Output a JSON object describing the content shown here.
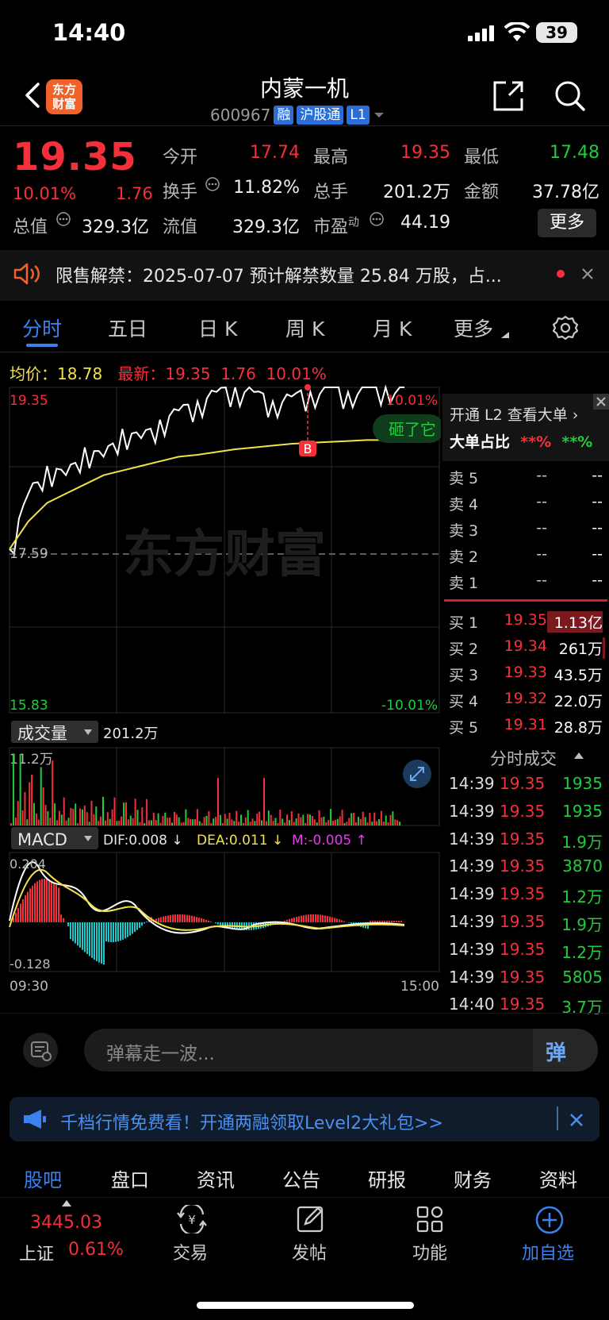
{
  "status_bar": {
    "time": "14:40",
    "battery": "39"
  },
  "header": {
    "logo_text": "东方\n财富",
    "title": "内蒙一机",
    "code": "600967",
    "tags": [
      "融",
      "沪股通",
      "L1"
    ]
  },
  "quote": {
    "price": "19.35",
    "change_pct": "10.01%",
    "change": "1.76",
    "fields": [
      {
        "label": "今开",
        "value": "17.74",
        "color": "red"
      },
      {
        "label": "最高",
        "value": "19.35",
        "color": "red"
      },
      {
        "label": "最低",
        "value": "17.48",
        "color": "green"
      },
      {
        "label": "换手",
        "value": "11.82%",
        "color": "white"
      },
      {
        "label": "总手",
        "value": "201.2万",
        "color": "white"
      },
      {
        "label": "金额",
        "value": "37.78亿",
        "color": "white"
      },
      {
        "label": "总值",
        "value": "329.3亿",
        "color": "white"
      },
      {
        "label": "流值",
        "value": "329.3亿",
        "color": "white"
      },
      {
        "label": "市盈",
        "label_sup": "动",
        "value": "44.19",
        "color": "white"
      }
    ],
    "more_label": "更多"
  },
  "notice": {
    "text": "限售解禁：2025-07-07 预计解禁数量 25.84 万股，占..."
  },
  "chart_tabs": [
    "分时",
    "五日",
    "日 K",
    "周 K",
    "月 K",
    "更多"
  ],
  "chart_info": {
    "avg_label": "均价：",
    "avg_value": "18.78",
    "latest_label": "最新：",
    "latest_value": "19.35",
    "latest_change": "1.76",
    "latest_pct": "10.01%"
  },
  "chart_axes": {
    "y_top": "19.35",
    "y_mid": "17.59",
    "y_bottom": "15.83",
    "pct_top": "10.01%",
    "pct_bottom": "-10.01%",
    "time_start": "09:30",
    "time_end": "15:00",
    "watermark": "东方财富",
    "marker": "B",
    "bubble": "砸了它"
  },
  "volume_panel": {
    "label": "成交量",
    "value": "201.2万",
    "max_label": "11.2万"
  },
  "macd_panel": {
    "label": "MACD",
    "dif": "DIF:0.008 ↓",
    "dea": "DEA:0.011 ↓",
    "m": "M:-0.005 ↑",
    "top_label": "0.204",
    "bottom_label": "-0.128"
  },
  "chart_data": {
    "type": "line",
    "title": "",
    "series": [
      {
        "name": "",
        "values": [
          17.6,
          18.2,
          18.5,
          18.4,
          18.7,
          18.6,
          18.9,
          18.8,
          19.0,
          19.1,
          19.2,
          19.3,
          19.35,
          19.3,
          19.2,
          19.25,
          19.3,
          19.35,
          19.3,
          19.35,
          19.35,
          19.35
        ]
      },
      {
        "name": "",
        "values": [
          17.6,
          17.9,
          18.1,
          18.2,
          18.3,
          18.4,
          18.45,
          18.5,
          18.55,
          18.6,
          18.62,
          18.65,
          18.68,
          18.7,
          18.72,
          18.74,
          18.75,
          18.76,
          18.77,
          18.78,
          18.78,
          18.78
        ]
      }
    ],
    "ylim": [
      15.83,
      19.35
    ]
  },
  "order_book": {
    "promo": "开通 L2 查看大单 ›",
    "ratio_label": "大单占比",
    "ratio_a": "**%",
    "ratio_b": "**%",
    "sells": [
      {
        "label": "卖 5",
        "price": "--",
        "vol": "--"
      },
      {
        "label": "卖 4",
        "price": "--",
        "vol": "--"
      },
      {
        "label": "卖 3",
        "price": "--",
        "vol": "--"
      },
      {
        "label": "卖 2",
        "price": "--",
        "vol": "--"
      },
      {
        "label": "卖 1",
        "price": "--",
        "vol": "--"
      }
    ],
    "buys": [
      {
        "label": "买 1",
        "price": "19.35",
        "vol": "1.13亿"
      },
      {
        "label": "买 2",
        "price": "19.34",
        "vol": "261万"
      },
      {
        "label": "买 3",
        "price": "19.33",
        "vol": "43.5万"
      },
      {
        "label": "买 4",
        "price": "19.32",
        "vol": "22.0万"
      },
      {
        "label": "买 5",
        "price": "19.31",
        "vol": "28.8万"
      }
    ]
  },
  "ticks": {
    "title": "分时成交",
    "rows": [
      {
        "time": "14:39",
        "price": "19.35",
        "vol": "1935"
      },
      {
        "time": "14:39",
        "price": "19.35",
        "vol": "1935"
      },
      {
        "time": "14:39",
        "price": "19.35",
        "vol": "1.9万"
      },
      {
        "time": "14:39",
        "price": "19.35",
        "vol": "3870"
      },
      {
        "time": "14:39",
        "price": "19.35",
        "vol": "1.2万"
      },
      {
        "time": "14:39",
        "price": "19.35",
        "vol": "1.9万"
      },
      {
        "time": "14:39",
        "price": "19.35",
        "vol": "1.2万"
      },
      {
        "time": "14:39",
        "price": "19.35",
        "vol": "5805"
      },
      {
        "time": "14:40",
        "price": "19.35",
        "vol": "3.7万"
      }
    ]
  },
  "danmaku": {
    "placeholder": "弹幕走一波...",
    "button": "弹"
  },
  "promo_banner": {
    "text": "千档行情免费看！开通两融领取Level2大礼包>>"
  },
  "bottom_tabs": [
    "股吧",
    "盘口",
    "资讯",
    "公告",
    "研报",
    "财务",
    "资料"
  ],
  "nav": {
    "index_value": "3445.03",
    "index_name": "上证",
    "index_pct": "0.61%",
    "items": [
      "交易",
      "发帖",
      "功能",
      "加自选"
    ]
  },
  "colors": {
    "up": "#f5303a",
    "down": "#1fce3b",
    "accent": "#3b82f0",
    "avg": "#f2e24a"
  }
}
